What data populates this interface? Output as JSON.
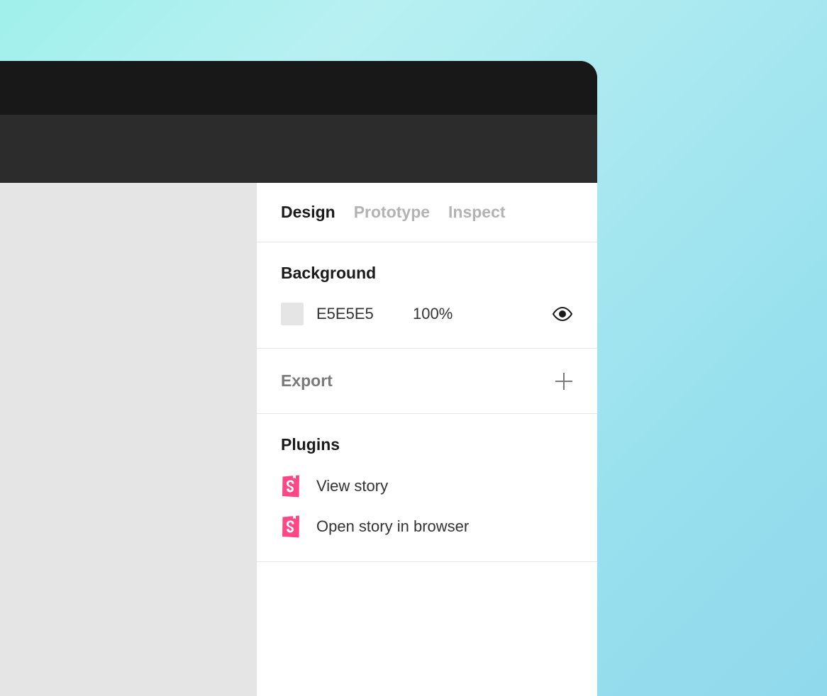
{
  "tabs": {
    "design": "Design",
    "prototype": "Prototype",
    "inspect": "Inspect"
  },
  "background": {
    "title": "Background",
    "hex": "E5E5E5",
    "opacity": "100%"
  },
  "export": {
    "title": "Export"
  },
  "plugins": {
    "title": "Plugins",
    "items": [
      {
        "label": "View story"
      },
      {
        "label": "Open story in browser"
      }
    ]
  }
}
